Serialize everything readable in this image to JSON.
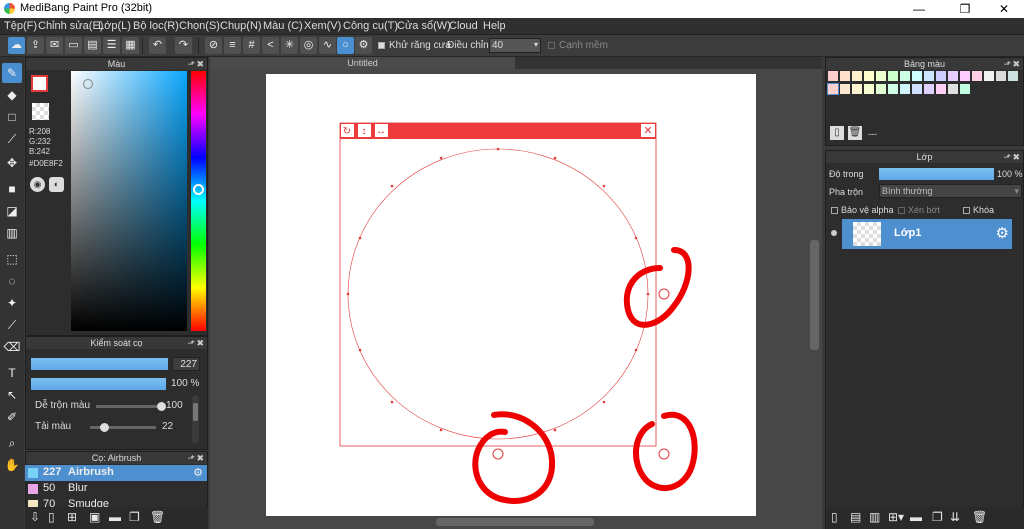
{
  "window": {
    "title": "MediBang Paint Pro (32bit)",
    "min": "—",
    "max": "❐",
    "close": "✕"
  },
  "menu": [
    "Tệp(F)",
    "Chỉnh sửa(E)",
    "Lớp(L)",
    "Bộ lọc(R)",
    "Chọn(S)",
    "Chụp(N)",
    "Màu (C)",
    "Xem(V)",
    "Công cụ(T)",
    "Cửa sổ(W)",
    "Cloud",
    "Help"
  ],
  "toolbar": {
    "antialias_label": "Khử răng cưa",
    "adjust_label": "Điều chỉnh",
    "adjust_value": "40",
    "smooth_edge_label": "Cạnh mềm"
  },
  "color_panel": {
    "title": "Màu",
    "r": "R:208",
    "g": "G:232",
    "b": "B:242",
    "hex": "#D0E8F2",
    "main_color": "#D0E8F2",
    "accent": "#e23b3b"
  },
  "brush_control": {
    "title": "Kiểm soát cọ",
    "size": "227",
    "opacity": "100 %",
    "blend_label": "Dễ trộn màu",
    "blend_value": "100",
    "blend_level": 1.0,
    "load_label": "Tải màu",
    "load_value": "22",
    "load_level": 0.22
  },
  "brush_list": {
    "title": "Cọ: Airbrush",
    "items": [
      {
        "size": "227",
        "name": "Airbrush",
        "color": "#79d1f5"
      },
      {
        "size": "50",
        "name": "Blur",
        "color": "#e9a6e6"
      },
      {
        "size": "70",
        "name": "Smudge",
        "color": "#f3e6c0"
      }
    ]
  },
  "canvas": {
    "tab": "Untitled"
  },
  "palette": {
    "title": "Bảng màu",
    "empty": "---",
    "colors": [
      "#ffcccc",
      "#ffe0cc",
      "#fff0cc",
      "#ffffcc",
      "#eaffcc",
      "#ccffcc",
      "#ccffe6",
      "#ccffff",
      "#cce6ff",
      "#ccccff",
      "#e6ccff",
      "#ffccff",
      "#ffcce6",
      "#f0f0f0",
      "#d9d9d9",
      "#cce0e0",
      "#ffd0d0",
      "#ffe8d0",
      "#fff5d0",
      "#f5ffd0",
      "#e0ffd0",
      "#d0ffe8",
      "#d0f5ff",
      "#d0e0ff",
      "#e0d0ff",
      "#ffd0f5",
      "#e0e0e0",
      "#c0ffe0"
    ]
  },
  "layers": {
    "title": "Lớp",
    "opacity_label": "Độ trong",
    "opacity_value": "100 %",
    "blend_label": "Pha trộn",
    "blend_value": "Bình thường",
    "protect_alpha": "Bảo vệ alpha",
    "clip": "Xén bớt",
    "lock": "Khóa",
    "layer_name": "Lớp1"
  }
}
